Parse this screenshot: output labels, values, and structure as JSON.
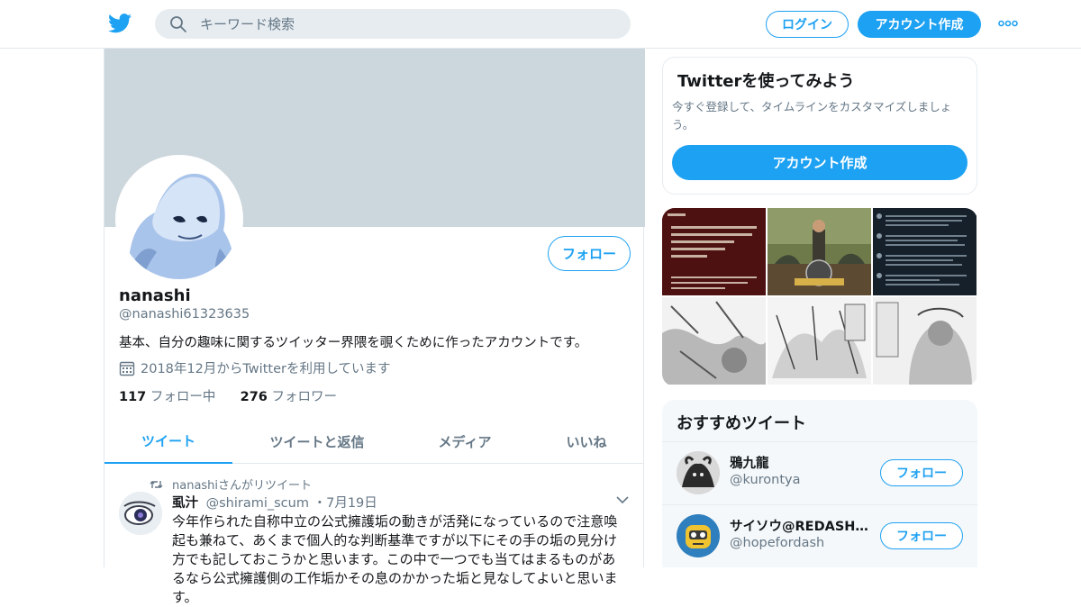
{
  "colors": {
    "accent": "#1da1f2",
    "text": "#14171a",
    "secondary_text": "#657786",
    "banner": "#ccd6dd",
    "border": "#e1e8ed"
  },
  "header": {
    "logo_icon": "twitter-bird-icon",
    "search_placeholder": "キーワード検索",
    "login_label": "ログイン",
    "signup_label": "アカウント作成",
    "more_icon": "more-dots-icon"
  },
  "profile": {
    "name": "nanashi",
    "handle": "@nanashi61323635",
    "bio": "基本、自分の趣味に関するツイッター界隈を覗くために作ったアカウントです。",
    "joined": "2018年12月からTwitterを利用しています",
    "following_count": "117",
    "following_label": "フォロー中",
    "followers_count": "276",
    "followers_label": "フォロワー",
    "follow_label": "フォロー"
  },
  "tabs": [
    {
      "label": "ツイート",
      "active": true
    },
    {
      "label": "ツイートと返信",
      "active": false
    },
    {
      "label": "メディア",
      "active": false
    },
    {
      "label": "いいね",
      "active": false
    }
  ],
  "tweet": {
    "retweet_label": "nanashiさんがリツイート",
    "author_name": "虱汁",
    "author_handle": "@shirami_scum",
    "separator": "・",
    "date": "7月19日",
    "text": "今年作られた自称中立の公式擁護垢の動きが活発になっているので注意喚起も兼ねて、あくまで個人的な判断基準ですが以下にその手の垢の見分け方でも記しておこうかと思います。この中で一つでも当てはまるものがあるなら公式擁護側の工作垢かその息のかかった垢と見なしてよいと思います。"
  },
  "sidebar": {
    "signup_card": {
      "title": "Twitterを使ってみよう",
      "description": "今すぐ登録して、タイムラインをカスタマイズしましょう。",
      "button_label": "アカウント作成"
    },
    "recommend": {
      "title": "おすすめツイート",
      "items": [
        {
          "name": "鴉九龍",
          "handle": "@kurontya",
          "follow_label": "フォロー"
        },
        {
          "name": "サイソウ@REDASH…",
          "handle": "@hopefordash",
          "follow_label": "フォロー"
        }
      ]
    }
  }
}
